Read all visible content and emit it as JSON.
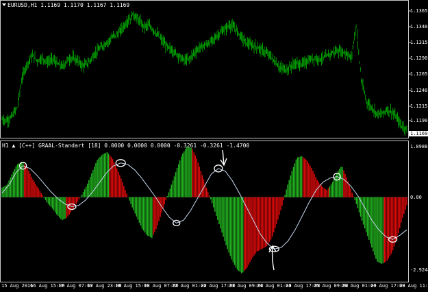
{
  "colors": {
    "background": "#000000",
    "grid": "#3a3a3a",
    "frame": "#c8c8c8",
    "candle": "#00c000",
    "bull_hist": "#22b51f",
    "bear_hist": "#e10a0a",
    "signal_line": "#c8d8ee",
    "annotation": "#ffffff"
  },
  "price_panel": {
    "title": "EURUSD,H1  1.1169 1.1170 1.1167 1.1169",
    "current_price": "1.1169",
    "y_labels": [
      "1.1365",
      "1.1340",
      "1.1315",
      "1.1290",
      "1.1265",
      "1.1240",
      "1.1215",
      "1.1190"
    ],
    "ylim": [
      1.1158,
      1.1373
    ],
    "close_series": [
      1.1185,
      1.1183,
      1.119,
      1.1205,
      1.1255,
      1.1278,
      1.129,
      1.1282,
      1.1286,
      1.128,
      1.1285,
      1.1276,
      1.1272,
      1.1284,
      1.1287,
      1.1281,
      1.1273,
      1.1278,
      1.129,
      1.1299,
      1.1307,
      1.1314,
      1.1322,
      1.1327,
      1.1338,
      1.135,
      1.1358,
      1.1349,
      1.1338,
      1.134,
      1.1332,
      1.1322,
      1.1311,
      1.1302,
      1.1297,
      1.129,
      1.1282,
      1.1285,
      1.1295,
      1.1303,
      1.1307,
      1.1311,
      1.1319,
      1.1327,
      1.1333,
      1.1341,
      1.1336,
      1.1325,
      1.1314,
      1.1308,
      1.1306,
      1.1302,
      1.1296,
      1.129,
      1.1279,
      1.127,
      1.1267,
      1.1272,
      1.1277,
      1.1276,
      1.1279,
      1.1284,
      1.1286,
      1.1285,
      1.1288,
      1.1294,
      1.1298,
      1.1297,
      1.1295,
      1.1286,
      1.134,
      1.125,
      1.1215,
      1.1205,
      1.1196,
      1.1193,
      1.1201,
      1.1198,
      1.1187,
      1.1174,
      1.1169
    ]
  },
  "indicator_panel": {
    "title": "H1 ▲ [C++] GRAAL-Standart [18] 0.0000 0.0000 0.0000 -0.3261 -0.3261 -1.4700",
    "y_top_label": "1.8988",
    "y_mid_label": "0.00",
    "y_bottom_label": "-2.9248",
    "ylim": [
      -2.9248,
      1.8988
    ],
    "histogram_values": [
      0.35,
      0.45,
      0.85,
      1.2,
      1.3,
      1.1,
      0.7,
      0.4,
      0.1,
      -0.2,
      -0.4,
      -0.65,
      -0.85,
      -0.75,
      -0.5,
      -0.2,
      0.1,
      0.45,
      0.9,
      1.35,
      1.55,
      1.65,
      1.45,
      1.05,
      0.6,
      0.1,
      -0.35,
      -0.75,
      -1.15,
      -1.4,
      -1.5,
      -1.1,
      -0.55,
      0.0,
      0.5,
      1.05,
      1.55,
      1.85,
      1.8,
      1.4,
      0.85,
      0.3,
      -0.2,
      -0.75,
      -1.3,
      -1.85,
      -2.3,
      -2.65,
      -2.8,
      -2.6,
      -2.25,
      -2.0,
      -1.9,
      -1.8,
      -1.5,
      -0.95,
      -0.35,
      0.35,
      0.95,
      1.45,
      1.5,
      1.35,
      1.05,
      0.65,
      0.4,
      0.25,
      0.5,
      0.9,
      1.15,
      0.7,
      0.2,
      -0.3,
      -0.85,
      -1.35,
      -1.85,
      -2.35,
      -2.45,
      -2.35,
      -2.05,
      -1.55,
      -0.85,
      -0.3
    ],
    "signal_values": [
      0.15,
      0.45,
      0.9,
      1.15,
      1.05,
      0.8,
      0.5,
      0.2,
      -0.05,
      -0.25,
      -0.35,
      -0.3,
      -0.1,
      0.2,
      0.55,
      0.9,
      1.15,
      1.25,
      1.2,
      1.0,
      0.7,
      0.35,
      0.0,
      -0.4,
      -0.75,
      -0.95,
      -0.85,
      -0.5,
      -0.05,
      0.4,
      0.85,
      1.05,
      0.95,
      0.6,
      0.15,
      -0.35,
      -0.85,
      -1.35,
      -1.7,
      -1.9,
      -1.85,
      -1.6,
      -1.2,
      -0.7,
      -0.2,
      0.25,
      0.55,
      0.7,
      0.75,
      0.65,
      0.4,
      0.05,
      -0.4,
      -0.85,
      -1.2,
      -1.45,
      -1.55,
      -1.4,
      -1.2
    ],
    "marker_indices": [
      3,
      12,
      20,
      30,
      39,
      48,
      56,
      65,
      74,
      90,
      100,
      108,
      118
    ],
    "annotations": [
      "down-arrow",
      "up-arrow"
    ]
  },
  "x_labels": [
    "15 Aug 2016",
    "16 Aug 15:00",
    "17 Aug 07:00",
    "17 Aug 23:00",
    "18 Aug 15:00",
    "19 Aug 07:00",
    "22 Aug 01:00",
    "22 Aug 17:00",
    "23 Aug 09:00",
    "24 Aug 01:00",
    "24 Aug 17:00",
    "25 Aug 09:00",
    "26 Aug 01:00",
    "26 Aug 17:00",
    "29 Aug 11:00"
  ]
}
